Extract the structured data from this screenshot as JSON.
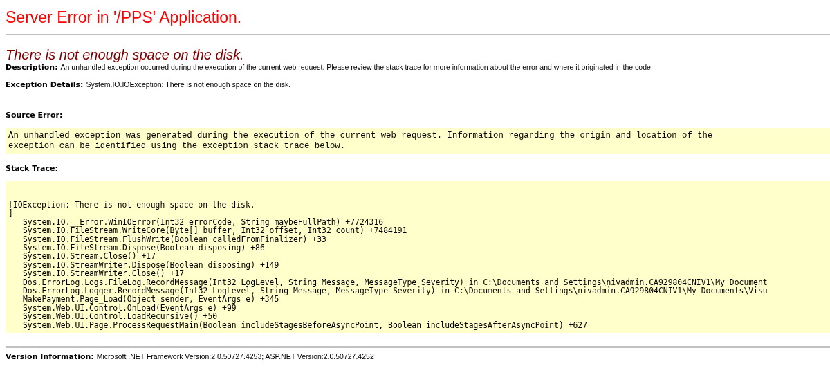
{
  "title": "Server Error in '/PPS' Application.",
  "error_heading": "There is not enough space on the disk.",
  "description": {
    "label": "Description:",
    "text": "An unhandled exception occurred during the execution of the current web request. Please review the stack trace for more information about the error and where it originated in the code."
  },
  "exception_details": {
    "label": "Exception Details:",
    "text": "System.IO.IOException: There is not enough space on the disk."
  },
  "source_error": {
    "label": "Source Error:",
    "lines": [
      "An unhandled exception was generated during the execution of the current web request. Information regarding the origin and location of the",
      "exception can be identified using the exception stack trace below."
    ]
  },
  "stack_trace": {
    "label": "Stack Trace:",
    "header": "[IOException: There is not enough space on the disk.",
    "closing": "]",
    "frames": [
      "System.IO.__Error.WinIOError(Int32 errorCode, String maybeFullPath) +7724316",
      "System.IO.FileStream.WriteCore(Byte[] buffer, Int32 offset, Int32 count) +7484191",
      "System.IO.FileStream.FlushWrite(Boolean calledFromFinalizer) +33",
      "System.IO.FileStream.Dispose(Boolean disposing) +86",
      "System.IO.Stream.Close() +17",
      "System.IO.StreamWriter.Dispose(Boolean disposing) +149",
      "System.IO.StreamWriter.Close() +17",
      "Dos.ErrorLog.Logs.FileLog.RecordMessage(Int32 LogLevel, String Message, MessageType Severity) in C:\\Documents and Settings\\nivadmin.CA929804CNIV1\\My Document",
      "Dos.ErrorLog.Logger.RecordMessage(Int32 LogLevel, String Message, MessageType Severity) in C:\\Documents and Settings\\nivadmin.CA929804CNIV1\\My Documents\\Visu",
      "MakePayment.Page_Load(Object sender, EventArgs e) +345",
      "System.Web.UI.Control.OnLoad(EventArgs e) +99",
      "System.Web.UI.Control.LoadRecursive() +50",
      "System.Web.UI.Page.ProcessRequestMain(Boolean includeStagesBeforeAsyncPoint, Boolean includeStagesAfterAsyncPoint) +627"
    ]
  },
  "version_information": {
    "label": "Version Information:",
    "text": "Microsoft .NET Framework Version:2.0.50727.4253; ASP.NET Version:2.0.50727.4252"
  }
}
